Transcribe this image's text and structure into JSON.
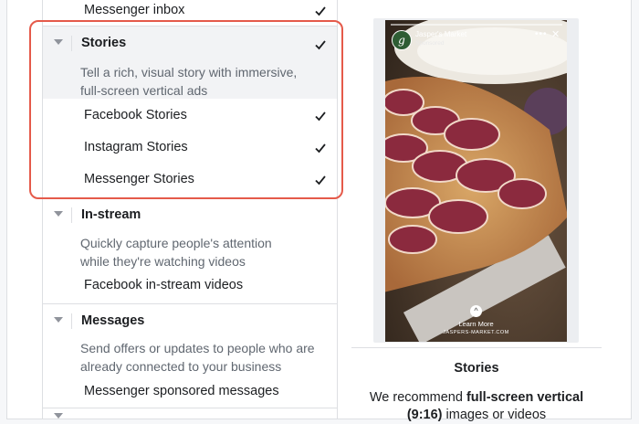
{
  "colors": {
    "accent": "#4267b2",
    "highlight": "#e55a4a",
    "selected_bg": "#f2f3f5"
  },
  "top_item": {
    "label": "Messenger inbox",
    "checked": true
  },
  "stories": {
    "title": "Stories",
    "description": "Tell a rich, visual story with immersive, full-screen vertical ads",
    "checked": true,
    "items": [
      {
        "label": "Facebook Stories",
        "checked": true
      },
      {
        "label": "Instagram Stories",
        "checked": true
      },
      {
        "label": "Messenger Stories",
        "checked": true
      }
    ]
  },
  "instream": {
    "title": "In-stream",
    "description": "Quickly capture people's attention while they're watching videos",
    "items": [
      {
        "label": "Facebook in-stream videos"
      }
    ]
  },
  "messages": {
    "title": "Messages",
    "description": "Send offers or updates to people who are already connected to your business",
    "items": [
      {
        "label": "Messenger sponsored messages"
      }
    ]
  },
  "preview": {
    "avatar_letter": "g",
    "brand": "Jasper's Market",
    "sponsored": "Sponsored",
    "more_icon": "ellipsis-icon",
    "close_icon": "close-icon",
    "cta": "Learn More",
    "site": "JASPERS-MARKET.COM"
  },
  "caption": {
    "title": "Stories",
    "body_prefix": "We recommend ",
    "body_bold": "full-screen vertical (9:16)",
    "body_suffix": " images or videos"
  }
}
